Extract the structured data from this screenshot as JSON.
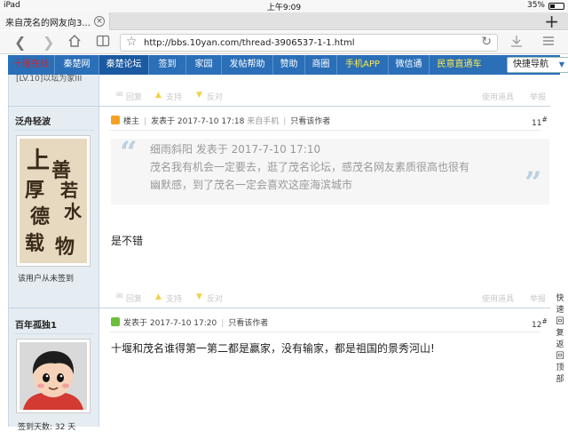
{
  "status": {
    "device": "iPad",
    "time": "上午9:09",
    "battery": "35%"
  },
  "tab": {
    "title": "来自茂名的网友向3...",
    "close": "×",
    "new_tab": "+"
  },
  "toolbar": {
    "url": "http://bbs.10yan.com/thread-3906537-1-1.html"
  },
  "nav": {
    "items": [
      "十堰在线",
      "秦楚网",
      "秦楚论坛",
      "签到",
      "家园",
      "发帖帮助",
      "赞助",
      "商圈",
      "手机APP",
      "微信通",
      "民意直通车"
    ],
    "quick_nav": "快捷导航"
  },
  "prev_post": {
    "user_level": "[LV.10]以坛为家III",
    "actions": [
      "回复",
      "支持",
      "反对"
    ],
    "tools": [
      "使用道具",
      "举报"
    ]
  },
  "post11": {
    "username": "泛舟轻波",
    "avatar_text": "上善若水 厚德载物",
    "signin_status": "该用户从未签到",
    "owner_label": "楼主",
    "posted": "发表于 2017-7-10 17:18",
    "via": "来自手机",
    "author_only": "只看该作者",
    "floor": "11",
    "quote_header": "细雨斜阳 发表于 2017-7-10 17:10",
    "quote_line1": "茂名我有机会一定要去，逛了茂名论坛，感茂名网友素质很高也很有",
    "quote_line2": "幽默感，到了茂名一定会喜欢这座海滨城市",
    "body": "是不错",
    "actions": [
      "回复",
      "支持",
      "反对"
    ],
    "tools": [
      "使用道具",
      "举报"
    ]
  },
  "post12": {
    "username": "百年孤独1",
    "posted": "发表于 2017-7-10 17:20",
    "author_only": "只看该作者",
    "floor": "12",
    "body": "十堰和茂名谁得第一第二都是赢家，没有输家，都是祖国的景秀河山!",
    "partial_stat": "签到天数: 32 天"
  },
  "back_to_top": "快速回复返回顶部",
  "colors": {
    "nav_bg": "#2a6fb8",
    "side_bg": "#e5edf2",
    "quote_mark": "#bcd0e0"
  }
}
